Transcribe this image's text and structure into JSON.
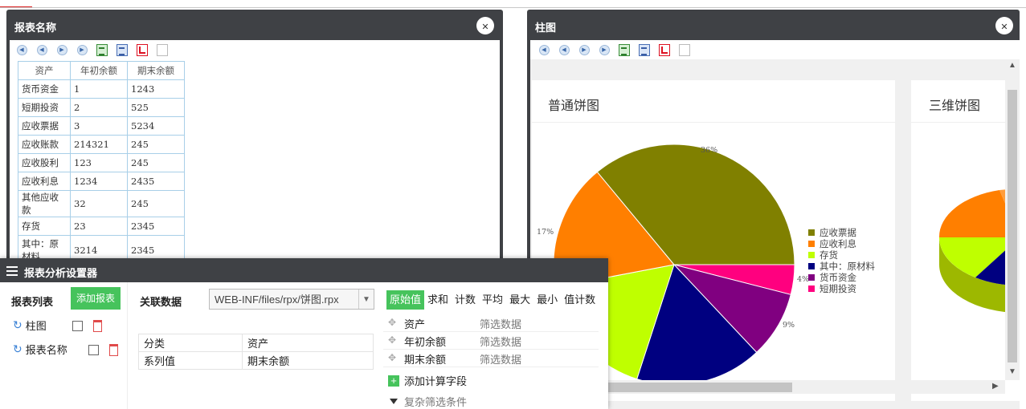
{
  "left_window": {
    "title": "报表名称",
    "table": {
      "headers": [
        "资产",
        "年初余额",
        "期末余额"
      ],
      "rows": [
        [
          "货币资金",
          "1",
          "1243"
        ],
        [
          "短期投资",
          "2",
          "525"
        ],
        [
          "应收票据",
          "3",
          "5234"
        ],
        [
          "应收账款",
          "214321",
          "245"
        ],
        [
          "应收股利",
          "123",
          "245"
        ],
        [
          "应收利息",
          "1234",
          "2435"
        ],
        [
          "其他应收款",
          "32",
          "245"
        ],
        [
          "存货",
          "23",
          "2345"
        ],
        [
          "其中：原材料",
          "3214",
          "2345"
        ]
      ]
    }
  },
  "right_window": {
    "title": "柱图",
    "card1_title": "普通饼图",
    "card2_title": "三维饼图"
  },
  "chart_data": {
    "type": "pie",
    "title": "普通饼图",
    "slices": [
      {
        "label": "应收票据",
        "value": 36,
        "color": "#808000"
      },
      {
        "label": "应收利息",
        "value": 17,
        "color": "#ff7f00"
      },
      {
        "label": "存货",
        "value": 17,
        "color": "#bfff00"
      },
      {
        "label": "其中：原材料",
        "value": 17,
        "color": "#000080"
      },
      {
        "label": "货币资金",
        "value": 9,
        "color": "#800080"
      },
      {
        "label": "短期投资",
        "value": 4,
        "color": "#ff007f"
      }
    ],
    "data_labels": [
      "36%",
      "17%",
      "17%",
      "9%",
      "4%"
    ],
    "legend_position": "right"
  },
  "settings_panel": {
    "title": "报表分析设置器",
    "report_list_label": "报表列表",
    "add_report_label": "添加报表",
    "reports": [
      "柱图",
      "报表名称"
    ],
    "linked_data_label": "关联数据",
    "file_path": "WEB-INF/files/rpx/饼图.rpx",
    "mapping": [
      {
        "key": "分类",
        "value": "资产"
      },
      {
        "key": "系列值",
        "value": "期末余额"
      }
    ],
    "tabs": [
      "原始值",
      "求和",
      "计数",
      "平均",
      "最大",
      "最小",
      "值计数"
    ],
    "fields": [
      {
        "name": "资产",
        "filter": "筛选数据"
      },
      {
        "name": "年初余额",
        "filter": "筛选数据"
      },
      {
        "name": "期末余额",
        "filter": "筛选数据"
      }
    ],
    "add_calc_label": "添加计算字段",
    "complex_filter_label": "复杂筛选条件"
  }
}
